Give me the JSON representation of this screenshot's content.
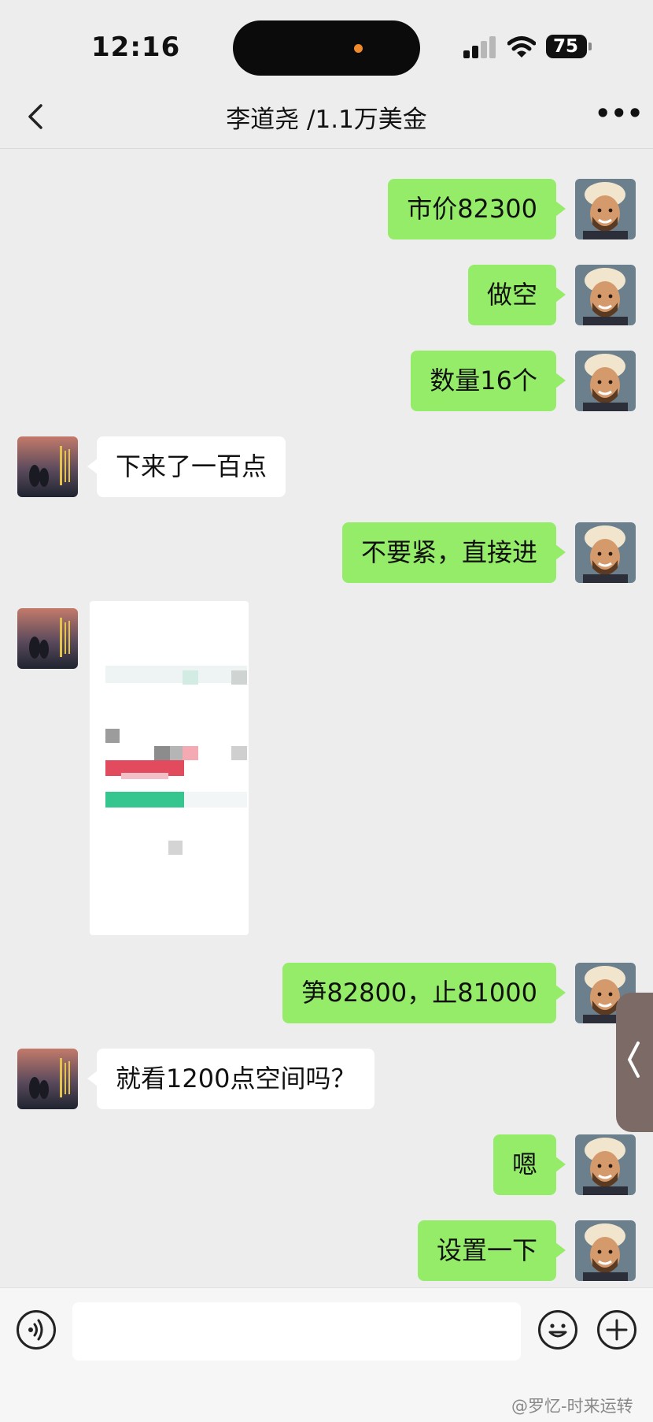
{
  "status_bar": {
    "time": "12:16",
    "battery": "75"
  },
  "header": {
    "title": "李道尧 /1.1万美金"
  },
  "messages": [
    {
      "side": "out",
      "text": "市价82300"
    },
    {
      "side": "out",
      "text": "做空"
    },
    {
      "side": "out",
      "text": "数量16个"
    },
    {
      "side": "in",
      "text": "下来了一百点"
    },
    {
      "side": "out",
      "text": "不要紧，直接进"
    },
    {
      "side": "in",
      "type": "image"
    },
    {
      "side": "out",
      "text": "笋82800，止81000"
    },
    {
      "side": "in",
      "text": "就看1200点空间吗？"
    },
    {
      "side": "out",
      "text": "嗯"
    },
    {
      "side": "out",
      "text": "设置一下"
    }
  ],
  "watermark": "@罗忆-时来运转",
  "icons": {
    "back": "chevron-left-icon",
    "more": "more-icon",
    "voice": "voice-icon",
    "emoji": "emoji-icon",
    "plus": "plus-icon"
  },
  "colors": {
    "outgoing_bubble": "#95ec69",
    "incoming_bubble": "#ffffff",
    "background": "#ededed"
  }
}
